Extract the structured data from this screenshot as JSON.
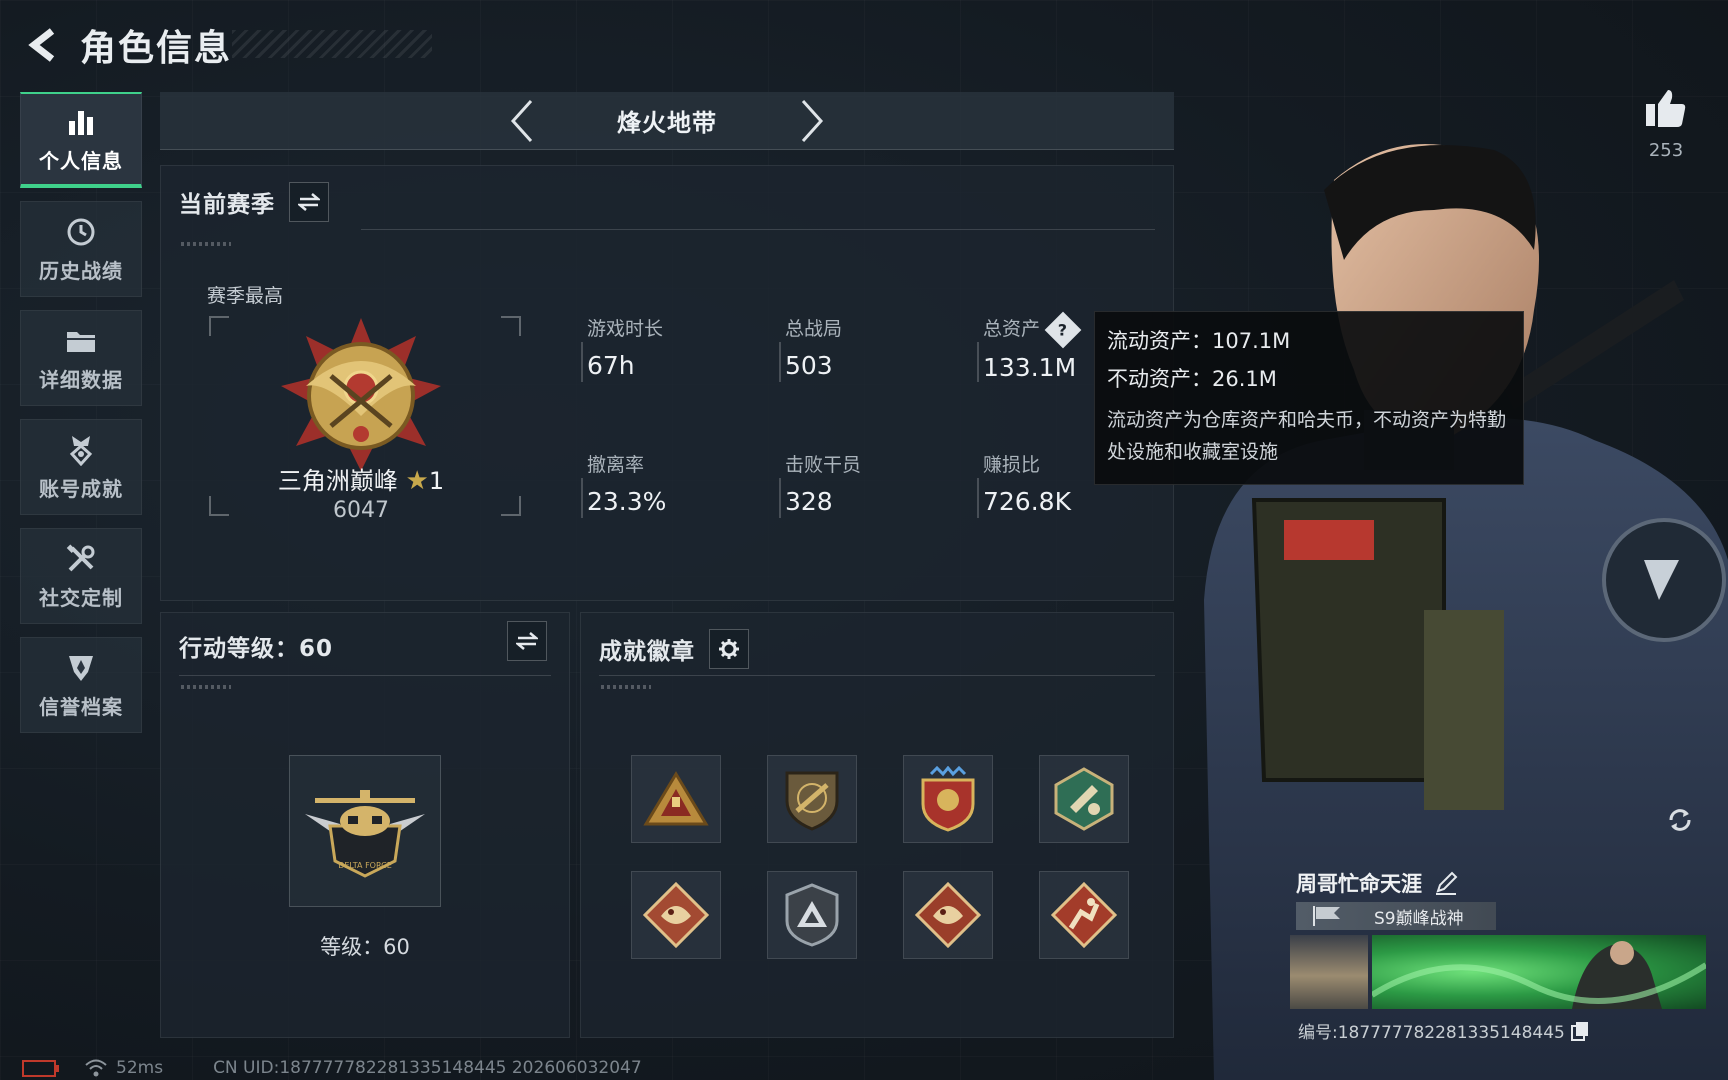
{
  "header": {
    "title": "角色信息"
  },
  "sidenav": {
    "items": [
      {
        "label": "个人信息",
        "icon": "bar-chart-icon",
        "active": true
      },
      {
        "label": "历史战绩",
        "icon": "clock-icon"
      },
      {
        "label": "详细数据",
        "icon": "folder-icon"
      },
      {
        "label": "账号成就",
        "icon": "medal-icon"
      },
      {
        "label": "社交定制",
        "icon": "tools-icon"
      },
      {
        "label": "信誉档案",
        "icon": "shield-icon"
      }
    ]
  },
  "mode_bar": {
    "title": "烽火地带"
  },
  "season": {
    "title": "当前赛季",
    "best_label": "赛季最高",
    "rank_name": "三角洲巅峰",
    "rank_stars": "1",
    "rank_score": "6047",
    "stats": [
      {
        "label": "游戏时长",
        "value": "67h"
      },
      {
        "label": "总战局",
        "value": "503"
      },
      {
        "label": "总资产",
        "value": "133.1M"
      },
      {
        "label": "撤离率",
        "value": "23.3%"
      },
      {
        "label": "击败干员",
        "value": "328"
      },
      {
        "label": "赚损比",
        "value": "726.8K"
      }
    ]
  },
  "tooltip": {
    "liquid": "流动资产：107.1M",
    "fixed": "不动资产：26.1M",
    "desc": "流动资产为仓库资产和哈夫币，不动资产为特勤处设施和收藏室设施"
  },
  "level": {
    "title": "行动等级：60",
    "text": "等级：60"
  },
  "badges": {
    "title": "成就徽章",
    "items": [
      "warning-triangle-badge",
      "rifle-shield-badge",
      "eagle-crest-badge",
      "hex-emblem-badge",
      "dragon-diamond-badge",
      "delta-shield-badge",
      "dragon-diamond-badge",
      "runner-diamond-badge"
    ]
  },
  "player": {
    "likes": "253",
    "name": "周哥忙命天涯",
    "title_plate": "S9巅峰战神",
    "id": "编号:18777778228133514844​5"
  },
  "footer": {
    "ping": "52ms",
    "uid": "CN UID:1877777822813351484​45 202606032047"
  },
  "colors": {
    "accent": "#3fd18b",
    "gold": "#c8a94c",
    "panel": "#1c252e"
  }
}
